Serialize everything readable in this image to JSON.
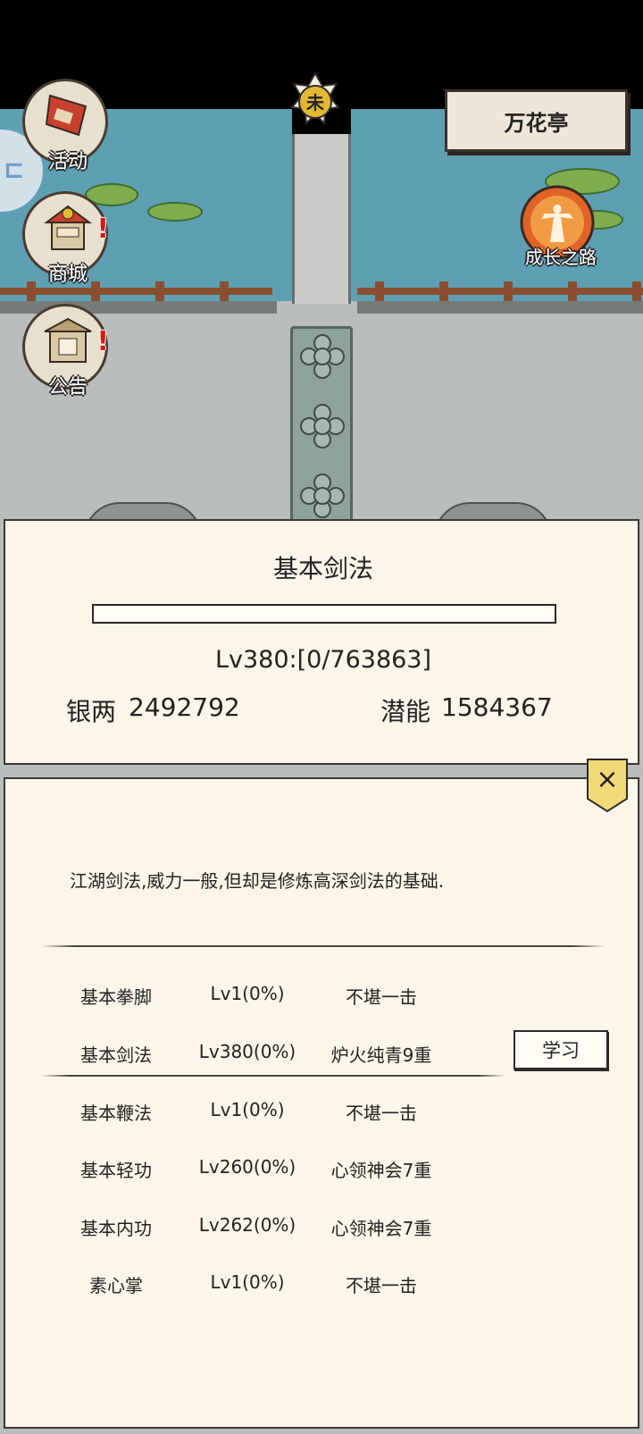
{
  "side_menu": [
    {
      "label": "活动",
      "icon": "banner-scroll-icon",
      "alert": false
    },
    {
      "label": "商城",
      "icon": "shop-stall-icon",
      "alert": true,
      "alert_mark": "!"
    },
    {
      "label": "公告",
      "icon": "notice-pavilion-icon",
      "alert": true,
      "alert_mark": "!"
    }
  ],
  "compass_char": "未",
  "location_button": "万花亭",
  "growth_label": "成长之路",
  "skill_panel": {
    "title": "基本剑法",
    "progress_fraction": 0,
    "level_text": "Lv380:[0/763863]",
    "silver_label": "银两",
    "silver_value": "2492792",
    "potential_label": "潜能",
    "potential_value": "1584367"
  },
  "detail_panel": {
    "close_label": "×",
    "description": "江湖剑法,威力一般,但却是修炼高深剑法的基础.",
    "skills": [
      {
        "name": "基本拳脚",
        "level": "Lv1(0%)",
        "rank": "不堪一击"
      },
      {
        "name": "基本剑法",
        "level": "Lv380(0%)",
        "rank": "炉火纯青9重",
        "selected": true
      },
      {
        "name": "基本鞭法",
        "level": "Lv1(0%)",
        "rank": "不堪一击"
      },
      {
        "name": "基本轻功",
        "level": "Lv260(0%)",
        "rank": "心领神会7重"
      },
      {
        "name": "基本内功",
        "level": "Lv262(0%)",
        "rank": "心领神会7重"
      },
      {
        "name": "素心掌",
        "level": "Lv1(0%)",
        "rank": "不堪一击"
      }
    ],
    "learn_button": "学习"
  },
  "colors": {
    "water": "#5e9fb3",
    "panel_bg": "#fbf6e9",
    "alert_red": "#d21b16",
    "growth_orange": "#e0632a"
  }
}
